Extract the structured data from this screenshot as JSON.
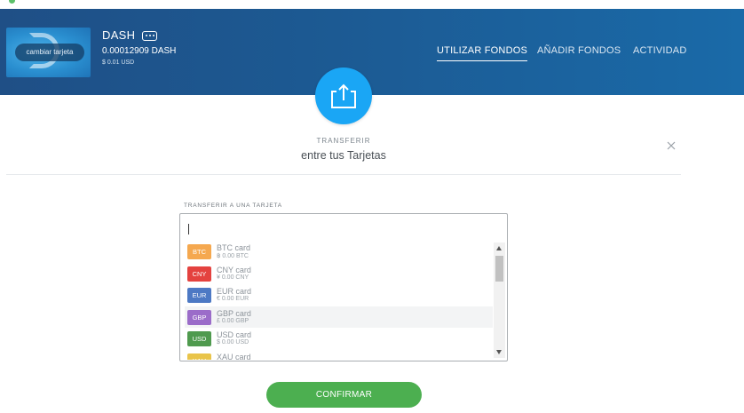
{
  "header": {
    "card_button_label": "cambiar tarjeta",
    "wallet_name": "DASH",
    "wallet_balance": "0.00012909 DASH",
    "wallet_fiat": "$ 0.01 USD",
    "nav": [
      "UTILIZAR FONDOS",
      "AÑADIR FONDOS",
      "ACTIVIDAD"
    ],
    "active_nav": "UTILIZAR FONDOS"
  },
  "transfer": {
    "small_title": "TRANSFERIR",
    "main_title": "entre tus Tarjetas",
    "field_label": "TRANSFERIR A UNA TARJETA",
    "input_value": ""
  },
  "cards": [
    {
      "code": "BTC",
      "name": "BTC card",
      "balance": "฿ 0.00 BTC",
      "color": "#f5a84f"
    },
    {
      "code": "CNY",
      "name": "CNY card",
      "balance": "¥ 0.00 CNY",
      "color": "#e4423f"
    },
    {
      "code": "EUR",
      "name": "EUR card",
      "balance": "€ 0.00 EUR",
      "color": "#4d79c4"
    },
    {
      "code": "GBP",
      "name": "GBP card",
      "balance": "£ 0.00 GBP",
      "color": "#9b6cc9"
    },
    {
      "code": "USD",
      "name": "USD card",
      "balance": "$ 0.00 USD",
      "color": "#4f9a4e"
    },
    {
      "code": "XAU",
      "name": "XAU card",
      "balance": "",
      "color": "#e9c44a"
    }
  ],
  "hover_index": 3,
  "confirm_label": "CONFIRMAR",
  "colors": {
    "header": "#1c5a93",
    "accent": "#1aa6f5",
    "confirm": "#4caf50"
  }
}
